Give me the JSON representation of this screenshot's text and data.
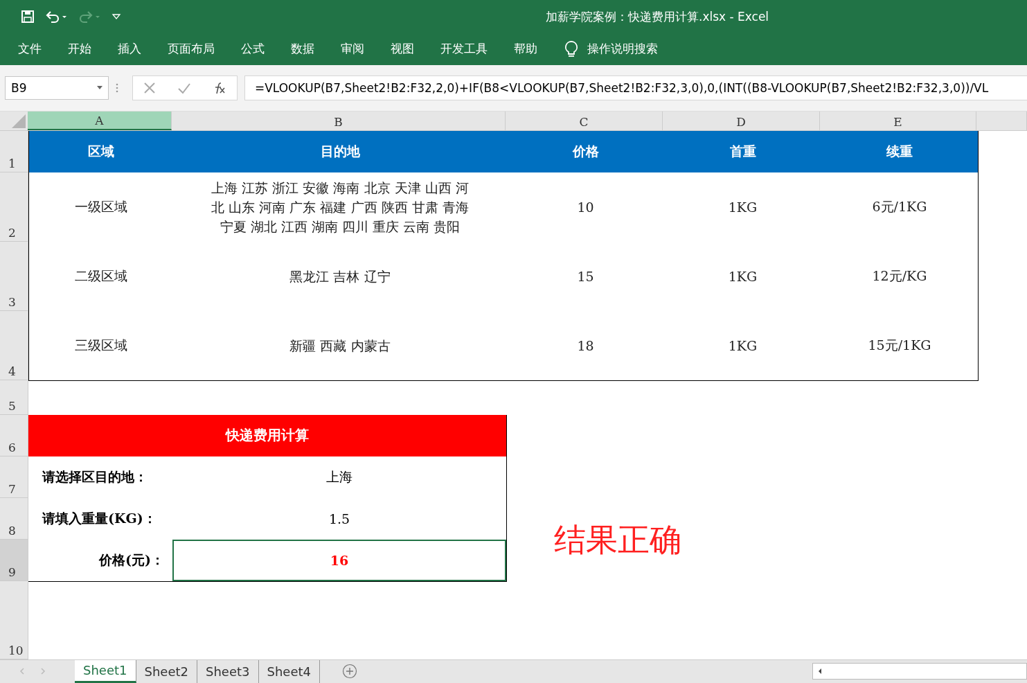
{
  "window": {
    "title": "加薪学院案例：快递费用计算.xlsx  -  Excel"
  },
  "menu": [
    {
      "label": "文件"
    },
    {
      "label": "开始"
    },
    {
      "label": "插入"
    },
    {
      "label": "页面布局"
    },
    {
      "label": "公式"
    },
    {
      "label": "数据"
    },
    {
      "label": "审阅"
    },
    {
      "label": "视图"
    },
    {
      "label": "开发工具"
    },
    {
      "label": "帮助"
    }
  ],
  "tell_me": "操作说明搜索",
  "name_box": "B9",
  "formula": "=VLOOKUP(B7,Sheet2!B2:F32,2,0)+IF(B8<VLOOKUP(B7,Sheet2!B2:F32,3,0),0,(INT((B8-VLOOKUP(B7,Sheet2!B2:F32,3,0))/VL",
  "columns": [
    {
      "label": "A",
      "selected": true
    },
    {
      "label": "B",
      "selected": false
    },
    {
      "label": "C",
      "selected": false
    },
    {
      "label": "D",
      "selected": false
    },
    {
      "label": "E",
      "selected": false
    }
  ],
  "row_numbers": [
    {
      "label": "1",
      "selected": false
    },
    {
      "label": "2",
      "selected": false
    },
    {
      "label": "3",
      "selected": false
    },
    {
      "label": "4",
      "selected": false
    },
    {
      "label": "5",
      "selected": false
    },
    {
      "label": "6",
      "selected": false
    },
    {
      "label": "7",
      "selected": false
    },
    {
      "label": "8",
      "selected": false
    },
    {
      "label": "9",
      "selected": true
    },
    {
      "label": "10",
      "selected": false
    }
  ],
  "rate_table": {
    "headers": [
      "区域",
      "目的地",
      "价格",
      "首重",
      "续重"
    ],
    "rows": [
      {
        "region": "一级区域",
        "destinations": [
          "上海 江苏 浙江 安徽 海南 北京 天津 山西 河",
          "北 山东 河南 广东 福建 广西 陕西 甘肃 青海",
          "宁夏 湖北 江西 湖南 四川 重庆 云南 贵阳"
        ],
        "price": "10",
        "first_weight": "1KG",
        "extra_weight": "6元/1KG"
      },
      {
        "region": "二级区域",
        "destinations": [
          "黑龙江 吉林 辽宁"
        ],
        "price": "15",
        "first_weight": "1KG",
        "extra_weight": "12元/KG"
      },
      {
        "region": "三级区域",
        "destinations": [
          "新疆 西藏 内蒙古"
        ],
        "price": "18",
        "first_weight": "1KG",
        "extra_weight": "15元/1KG"
      }
    ]
  },
  "calculator": {
    "title": "快递费用计算",
    "rows": [
      {
        "label": "请选择区目的地：",
        "value": "上海",
        "kind": "input"
      },
      {
        "label": "请填入重量(KG)：",
        "value": "1.5",
        "kind": "input"
      },
      {
        "label": "价格(元)：",
        "value": "16",
        "kind": "result"
      }
    ]
  },
  "note": "结果正确",
  "sheet_tabs": [
    {
      "label": "Sheet1",
      "selected": true
    },
    {
      "label": "Sheet2",
      "selected": false
    },
    {
      "label": "Sheet3",
      "selected": false
    },
    {
      "label": "Sheet4",
      "selected": false
    }
  ]
}
